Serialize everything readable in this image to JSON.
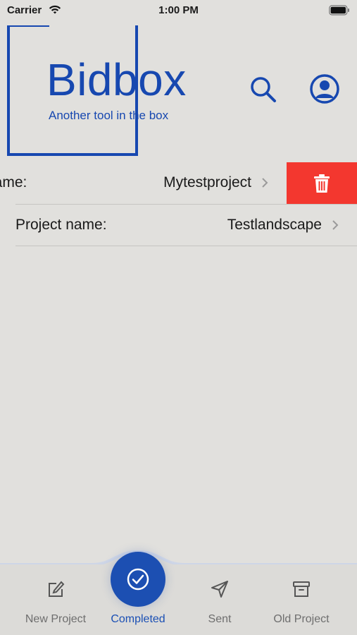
{
  "status_bar": {
    "carrier": "Carrier",
    "time": "1:00 PM"
  },
  "header": {
    "logo_title": "Bidbox",
    "logo_tagline": "Another tool in the box",
    "brand_color": "#1748b0"
  },
  "projects": [
    {
      "label": "name:",
      "value": "Mytestproject",
      "swiped": true
    },
    {
      "label": "Project name:",
      "value": "Testlandscape",
      "swiped": false
    }
  ],
  "delete_color": "#f3372f",
  "tabs": [
    {
      "label": "New Project",
      "icon": "edit-icon"
    },
    {
      "label": "Completed",
      "icon": "check-circle-icon",
      "active": true
    },
    {
      "label": "Sent",
      "icon": "send-icon"
    },
    {
      "label": "Old Project",
      "icon": "archive-icon"
    }
  ]
}
